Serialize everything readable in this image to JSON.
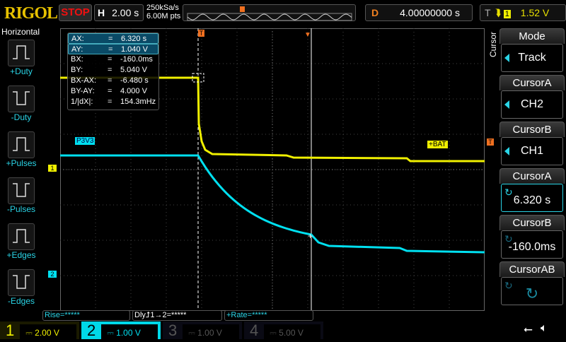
{
  "header": {
    "logo": "RIGOL",
    "run_state": "STOP",
    "h_label": "H",
    "timebase": "2.00 s",
    "sample_rate": "250kSa/s",
    "memory_depth": "6.00M pts",
    "d_label": "D",
    "delay": "4.00000000 s",
    "t_label": "T",
    "trigger_source": "1",
    "trigger_level": "1.52 V"
  },
  "left_menu": {
    "title": "Horizontal",
    "items": [
      {
        "label": "+Duty",
        "icon": "positive-duty-icon"
      },
      {
        "label": "-Duty",
        "icon": "negative-duty-icon"
      },
      {
        "label": "+Pulses",
        "icon": "positive-pulses-icon"
      },
      {
        "label": "-Pulses",
        "icon": "negative-pulses-icon"
      },
      {
        "label": "+Edges",
        "icon": "rising-edges-icon"
      },
      {
        "label": "-Edges",
        "icon": "falling-edges-icon"
      }
    ]
  },
  "measurements": [
    {
      "k": "AX:",
      "v": "6.320 s",
      "selected": true
    },
    {
      "k": "AY:",
      "v": "1.040 V",
      "selected": true
    },
    {
      "k": "BX:",
      "v": "-160.0ms"
    },
    {
      "k": "BY:",
      "v": "5.040 V"
    },
    {
      "k": "BX-AX:",
      "v": "-6.480 s"
    },
    {
      "k": "BY-AY:",
      "v": "4.000 V"
    },
    {
      "k": "1/|dX|:",
      "v": "154.3mHz"
    }
  ],
  "eq": "=",
  "traces": {
    "ch1_label": "+BAT",
    "ch2_label": "P3V3",
    "ch1_marker": "1",
    "ch2_marker": "2",
    "trigger_marker": "T",
    "ch1_color": "#f0f000",
    "ch2_color": "#00e0f0"
  },
  "right_menu": {
    "title": "Cursor",
    "items": [
      {
        "title": "Mode",
        "value": "Track"
      },
      {
        "title": "CursorA",
        "value": "CH2"
      },
      {
        "title": "CursorB",
        "value": "CH1"
      },
      {
        "title": "CursorA",
        "value": "6.320 s"
      },
      {
        "title": "CursorB",
        "value": "-160.0ms"
      },
      {
        "title": "CursorAB",
        "value": ""
      }
    ]
  },
  "bottom_measure": {
    "rise": "Rise=*****",
    "dly_prefix": "Dly",
    "dly_rest": "1→2=*****",
    "rate": "+Rate=*****"
  },
  "channels": [
    {
      "num": "1",
      "scale": "2.00 V",
      "color": "#f0f000"
    },
    {
      "num": "2",
      "scale": "1.00 V",
      "color": "#00e0f0"
    },
    {
      "num": "3",
      "scale": "1.00 V",
      "color": "#555"
    },
    {
      "num": "4",
      "scale": "5.00 V",
      "color": "#555"
    }
  ]
}
